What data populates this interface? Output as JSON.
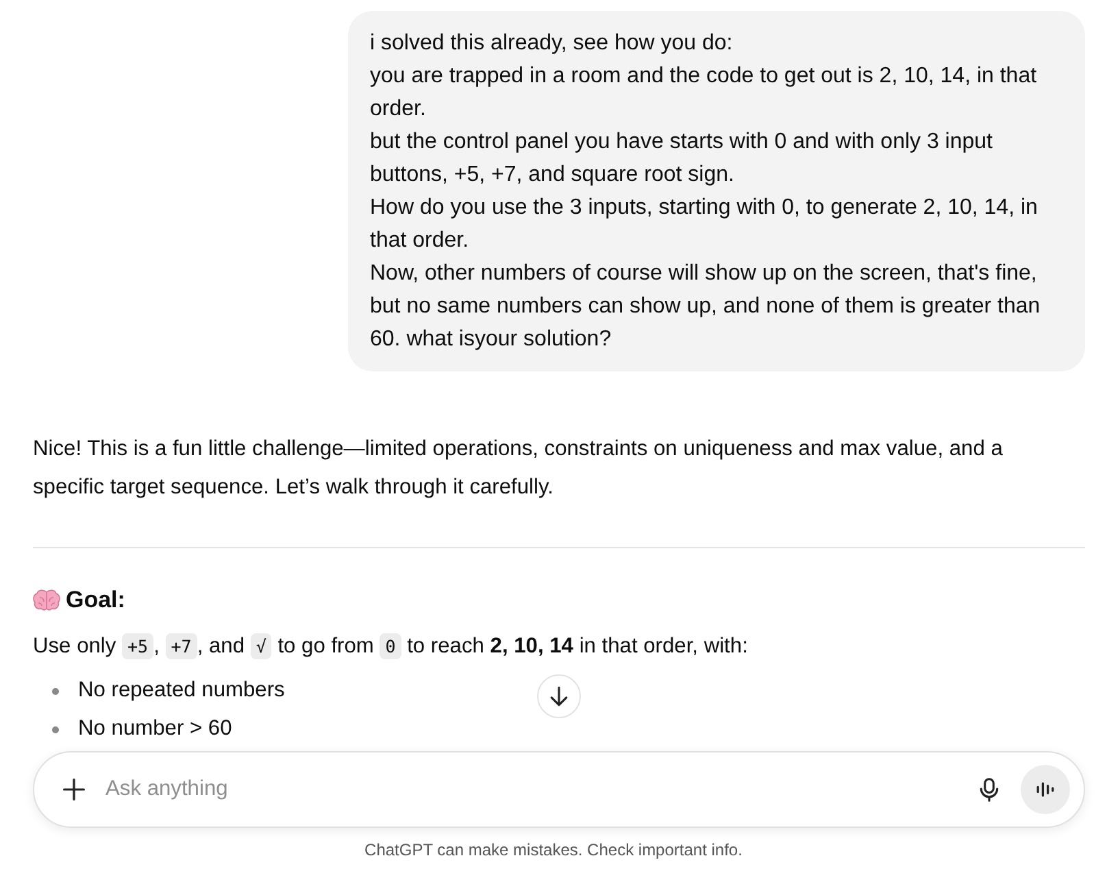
{
  "user_message": {
    "lines": [
      "i solved this already, see how you do:",
      "you are trapped in a room and the code to get out is 2, 10, 14, in that order.",
      "but the control panel you have starts with 0 and with only 3 input buttons, +5, +7, and square root sign.",
      "How do you use the 3 inputs, starting with 0, to generate 2, 10, 14, in that order.",
      "Now, other numbers of course will show up on the screen, that's fine, but no same numbers can show up, and none of them is greater than 60. what isyour solution?"
    ]
  },
  "assistant_message": {
    "intro": "Nice! This is a fun little challenge—limited operations, constraints on uniqueness and max value, and a specific target sequence. Let’s walk through it carefully.",
    "heading": "Goal:",
    "sentence": [
      {
        "kind": "text",
        "text": "Use only "
      },
      {
        "kind": "code",
        "text": "+5"
      },
      {
        "kind": "text",
        "text": ", "
      },
      {
        "kind": "code",
        "text": "+7"
      },
      {
        "kind": "text",
        "text": ", and "
      },
      {
        "kind": "code",
        "text": "√"
      },
      {
        "kind": "text",
        "text": " to go from "
      },
      {
        "kind": "code",
        "text": "0"
      },
      {
        "kind": "text",
        "text": " to reach **2, 10, 14** in that order, with:"
      }
    ],
    "bullets": [
      "No repeated numbers",
      "No number > 60"
    ]
  },
  "composer": {
    "placeholder": "Ask anything"
  },
  "footer": "ChatGPT can make mistakes. Check important info."
}
